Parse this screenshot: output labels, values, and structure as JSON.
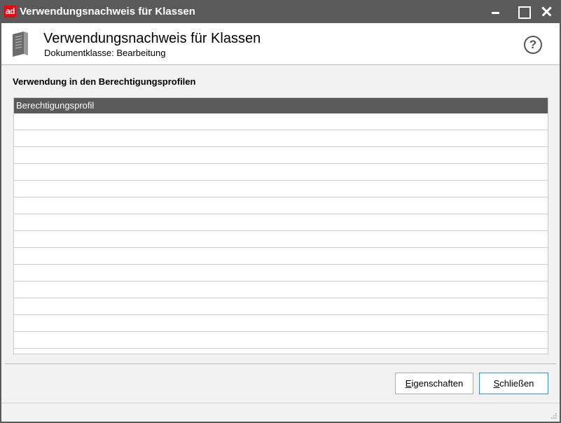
{
  "window": {
    "app_logo": "ad",
    "title": "Verwendungsnachweis für Klassen",
    "minimize_icon": "minimize-icon",
    "maximize_icon": "maximize-icon",
    "close_icon": "close-icon"
  },
  "header": {
    "icon": "book-icon",
    "title": "Verwendungsnachweis für Klassen",
    "subtitle": "Dokumentklasse: Bearbeitung",
    "help_icon": "help-icon",
    "help_glyph": "?"
  },
  "section": {
    "label": "Verwendung in den Berechtigungsprofilen"
  },
  "table": {
    "columns": [
      "Berechtigungsprofil"
    ],
    "rows": []
  },
  "buttons": {
    "properties": {
      "mnemonic": "E",
      "rest": "igenschaften"
    },
    "close": {
      "mnemonic": "S",
      "rest": "chließen"
    }
  },
  "colors": {
    "titlebar": "#5a5a5a",
    "logo": "#e30613",
    "focus": "#3b8fd6"
  }
}
